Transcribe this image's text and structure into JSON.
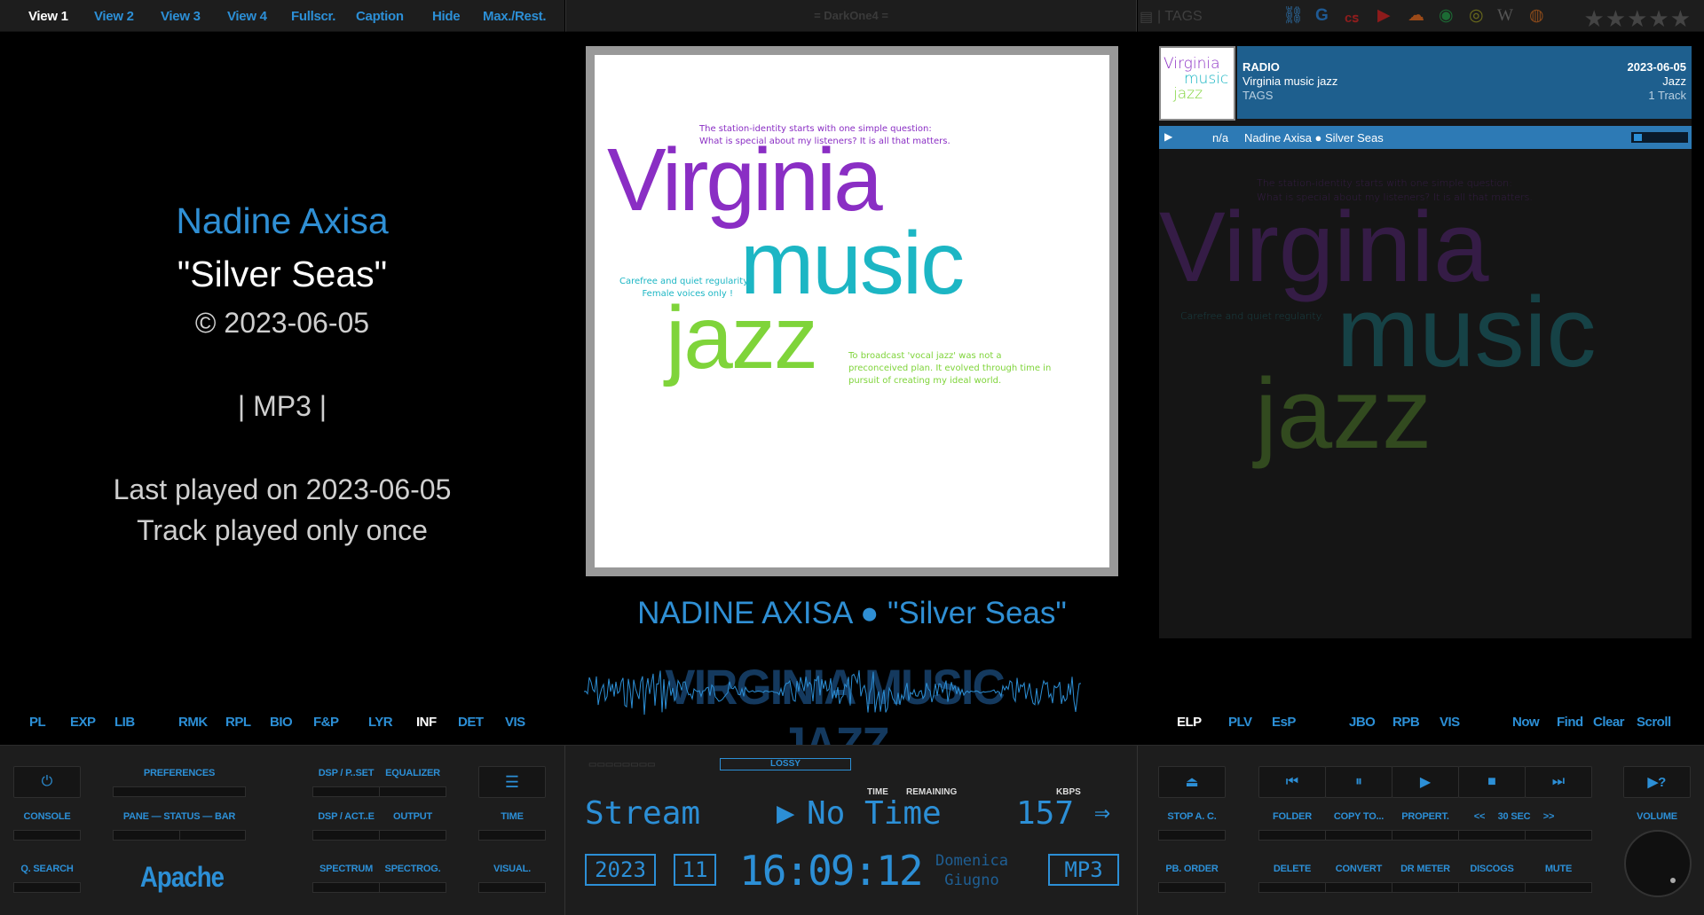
{
  "top": {
    "views": [
      "View 1",
      "View 2",
      "View 3",
      "View 4",
      "Fullscr.",
      "Caption",
      "Hide",
      "Max./Rest."
    ],
    "skin_name": "= DarkOne4 =",
    "tags_label": "| TAGS",
    "stars": "★★★★★"
  },
  "now_playing": {
    "artist": "Nadine Axisa",
    "title": "\"Silver Seas\"",
    "copyright": "© 2023-06-05",
    "format": "| MP3 |",
    "last_played": "Last played on 2023-06-05",
    "play_count": "Track played only once",
    "line": "NADINE AXISA ● \"Silver Seas\"",
    "wave_title": "VIRGINIA MUSIC JAZZ"
  },
  "album_art": {
    "tagline_1": "The station-identity starts with one simple question:",
    "tagline_2": "What is special about my listeners? It is all that matters.",
    "word_1": "Virginia",
    "word_2": "music",
    "word_3": "jazz",
    "note_1": "Carefree and quiet regularity.",
    "note_2": "Female voices only !",
    "note_3": "To broadcast 'vocal jazz' was not a",
    "note_4": "preconceived plan. It evolved through time in",
    "note_5": "pursuit of creating my ideal world.",
    "colors": {
      "purple": "#8a2ec4",
      "teal": "#1cb6c4",
      "green": "#7fd43a"
    }
  },
  "playlist": {
    "type": "RADIO",
    "name": "Virginia music jazz",
    "tags": "TAGS",
    "date": "2023-06-05",
    "genre": "Jazz",
    "count": "1 Track",
    "row": {
      "number": "n/a",
      "text": "Nadine Axisa ● Silver Seas"
    }
  },
  "tabs_left": [
    "PL",
    "EXP",
    "LIB",
    "RMK",
    "RPL",
    "BIO",
    "F&P",
    "LYR",
    "INF",
    "DET",
    "VIS"
  ],
  "tabs_right": [
    "ELP",
    "PLV",
    "EsP",
    "JBO",
    "RPB",
    "VIS",
    "Now",
    "Find",
    "Clear",
    "Scroll"
  ],
  "bottom_left": {
    "console": "CONSOLE",
    "q_search": "Q. SEARCH",
    "preferences": "PREFERENCES",
    "pane_status_bar": "PANE — STATUS — BAR",
    "apache": "Apache",
    "dsp_pset": "DSP / P..SET",
    "equalizer": "EQUALIZER",
    "dsp_act": "DSP / ACT..E",
    "output": "OUTPUT",
    "spectrum": "SPECTRUM",
    "spectrog": "SPECTROG.",
    "time": "TIME",
    "visual": "VISUAL."
  },
  "display": {
    "lossy": "LOSSY",
    "time_label": "TIME",
    "remaining_label": "REMAINING",
    "kbps_label": "KBPS",
    "source": "Stream",
    "time_value": "No Time",
    "bitrate": "157",
    "year": "2023",
    "month": "11",
    "clock": "16:09:12",
    "day": "Domenica",
    "month_name": "Giugno",
    "codec": "MP3"
  },
  "bottom_right": {
    "stop_ac": "STOP A. C.",
    "pb_order": "PB. ORDER",
    "folder": "FOLDER",
    "copy_to": "COPY TO...",
    "propert": "PROPERT.",
    "prev_30": "<<",
    "thirty_sec": "30 SEC",
    "next_30": ">>",
    "delete": "DELETE",
    "convert": "CONVERT",
    "dr_meter": "DR METER",
    "discogs": "DISCOGS",
    "mute": "MUTE",
    "volume": "VOLUME"
  }
}
